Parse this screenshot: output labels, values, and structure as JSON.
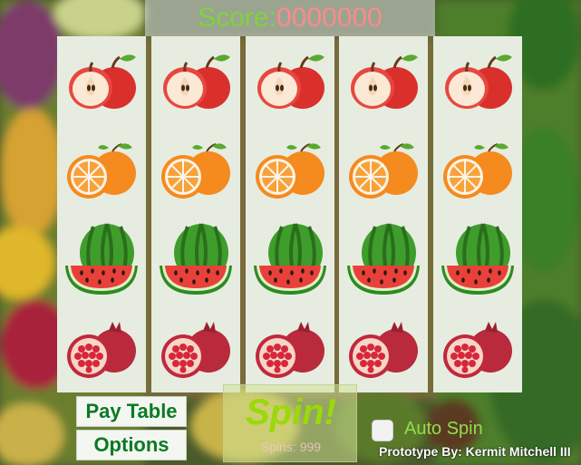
{
  "score": {
    "label": "Score:",
    "value": "0000000"
  },
  "reels": [
    [
      "apple",
      "orange",
      "watermelon",
      "pomegranate"
    ],
    [
      "apple",
      "orange",
      "watermelon",
      "pomegranate"
    ],
    [
      "apple",
      "orange",
      "watermelon",
      "pomegranate"
    ],
    [
      "apple",
      "orange",
      "watermelon",
      "pomegranate"
    ],
    [
      "apple",
      "orange",
      "watermelon",
      "pomegranate"
    ]
  ],
  "buttons": {
    "pay_table": "Pay Table",
    "options": "Options",
    "spin": "Spin!"
  },
  "spins": {
    "text": "Spins: 999"
  },
  "auto_spin": {
    "label": "Auto Spin",
    "checked": false
  },
  "credit": "Prototype By: Kermit Mitchell III",
  "colors": {
    "score_label": "#7fd43a",
    "score_value": "#ff8a8a",
    "button_text": "#0a7a22",
    "spin": "#9bd80c",
    "reel_bg": "#e6ede0"
  }
}
